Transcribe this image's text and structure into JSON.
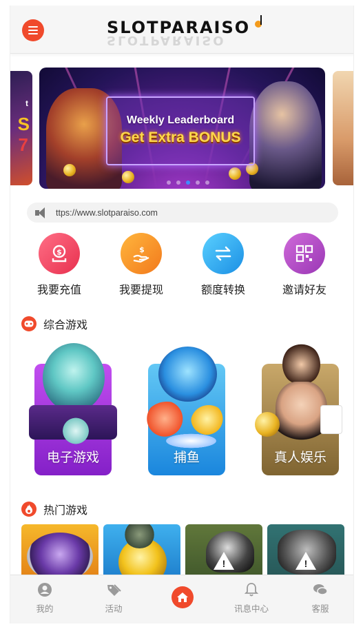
{
  "header": {
    "logo_text": "SLOTPARAISO",
    "logo_reflection": "SLOTPARAISO"
  },
  "banner": {
    "title": "Weekly Leaderboard",
    "subtitle": "Get Extra BONUS",
    "left_peek_text": "t",
    "left_peek_big": "S",
    "left_peek_num": "7",
    "dots_count": 5,
    "active_dot": 2
  },
  "marquee": {
    "text": "ttps://www.slotparaiso.com"
  },
  "actions": [
    {
      "label": "我要充值",
      "icon": "deposit-icon",
      "color": "#e8304e"
    },
    {
      "label": "我要提现",
      "icon": "withdraw-icon",
      "color": "#f2791c"
    },
    {
      "label": "额度转换",
      "icon": "transfer-icon",
      "color": "#1b8fe4"
    },
    {
      "label": "邀请好友",
      "icon": "qr-code-icon",
      "color": "#9a37b5"
    }
  ],
  "sections": {
    "games_title": "综合游戏",
    "hot_title": "热门游戏"
  },
  "categories": [
    {
      "label": "电子游戏",
      "color": "#8420c8"
    },
    {
      "label": "捕鱼",
      "color": "#1a86dd"
    },
    {
      "label": "真人娱乐",
      "color": "#7f6431"
    }
  ],
  "hot_games": [
    {
      "name": "hot-game-1",
      "color": "#f2a21c",
      "unavailable": false
    },
    {
      "name": "hot-game-2",
      "color": "#2a9ce0",
      "unavailable": false
    },
    {
      "name": "hot-game-3",
      "color": "#5d8a2a",
      "unavailable": true
    },
    {
      "name": "hot-game-4",
      "color": "#1c8a8a",
      "unavailable": true
    }
  ],
  "bottom_nav": [
    {
      "label": "我的",
      "icon": "user-icon"
    },
    {
      "label": "活动",
      "icon": "tag-icon"
    },
    {
      "label": "",
      "icon": "home-icon"
    },
    {
      "label": "讯息中心",
      "icon": "bell-icon"
    },
    {
      "label": "客服",
      "icon": "chat-icon"
    }
  ],
  "colors": {
    "accent": "#f04a2c",
    "nav_gray": "#8e8e8e"
  }
}
